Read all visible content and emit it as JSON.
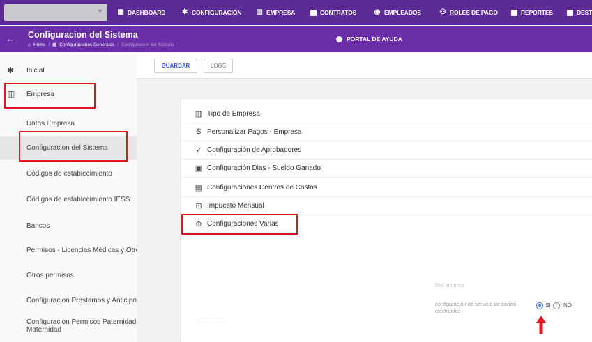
{
  "topnav": {
    "items": [
      {
        "label": "DASHBOARD",
        "icon": "dashboard-grid-icon"
      },
      {
        "label": "CONFIGURACIÓN",
        "icon": "gear-icon"
      },
      {
        "label": "EMPRESA",
        "icon": "building-icon"
      },
      {
        "label": "CONTRATOS",
        "icon": "contract-icon"
      },
      {
        "label": "EMPLEADOS",
        "icon": "employees-icon"
      },
      {
        "label": "ROLES DE PAGO",
        "icon": "people-group-icon"
      },
      {
        "label": "REPORTES",
        "icon": "report-icon"
      },
      {
        "label": "DEST",
        "icon": "document-icon"
      }
    ]
  },
  "header": {
    "title": "Configuracion del Sistema",
    "breadcrumb": [
      "Home",
      "Configuraciones Generales",
      "Configuracion del Sistema"
    ],
    "help_label": "PORTAL DE AYUDA"
  },
  "toolbar": {
    "save_label": "GUARDAR",
    "logs_label": "LOGS"
  },
  "sidebar": {
    "top_items": [
      {
        "label": "Inicial",
        "icon": "gear-icon"
      },
      {
        "label": "Empresa",
        "icon": "building-icon"
      }
    ],
    "sub_items": [
      "Datos Empresa",
      "Configuracion del Sistema",
      "Códigos de establecimiento",
      "Códigos de establecimiento IESS",
      "Bancos",
      "Permisos - Licencias Médicas y Otros",
      "Otros permisos",
      "Configuracion Prestamos y Anticipos",
      "Configuracion Permisos Paternidad Maternidad"
    ],
    "selected": "Configuracion del Sistema"
  },
  "menu": {
    "items": [
      {
        "label": "Tipo de Empresa",
        "icon": "building-icon"
      },
      {
        "label": "Personalizar Pagos - Empresa",
        "icon": "dollar-circle-icon"
      },
      {
        "label": "Configuración de Aprobadores",
        "icon": "check-icon"
      },
      {
        "label": "Configuración Dias - Sueldo Ganado",
        "icon": "calendar-icon"
      },
      {
        "label": "Configuraciones Centros de Costos",
        "icon": "chart-icon"
      },
      {
        "label": "Impuesto Mensual",
        "icon": "money-icon"
      },
      {
        "label": "Configuraciones Varias",
        "icon": "globe-icon"
      }
    ]
  },
  "settings": {
    "faded_text": "Mail empresa",
    "mail_service_label": "configuracion de servicio de correo electronico",
    "options": [
      "SI",
      "NO"
    ],
    "selected": "SI"
  },
  "colors": {
    "topbar": "#5b2a95",
    "subbar": "#6a2fa8",
    "highlight_red": "#e1161b",
    "accent_blue": "#3a57d8"
  }
}
